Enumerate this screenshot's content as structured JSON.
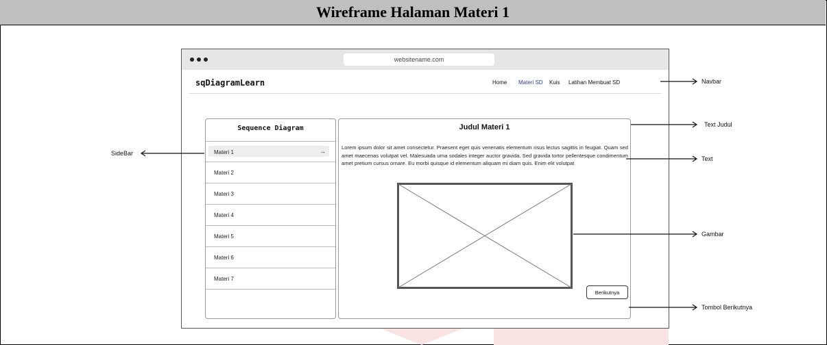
{
  "header": {
    "title": "Wireframe Halaman Materi 1"
  },
  "browser": {
    "url": "websitename.com",
    "brand": "sqDiagramLearn",
    "nav": [
      {
        "label": "Home",
        "active": false
      },
      {
        "label": "Materi SD",
        "active": true
      },
      {
        "label": "Kuis",
        "active": false
      },
      {
        "label": "Latihan Membuat SD",
        "active": false
      }
    ]
  },
  "sidebar": {
    "title": "Sequence Diagram",
    "items": [
      {
        "label": "Materi 1",
        "active": true,
        "arrow": "→"
      },
      {
        "label": "Materi 2",
        "active": false
      },
      {
        "label": "Materi 3",
        "active": false
      },
      {
        "label": "Materi 4",
        "active": false
      },
      {
        "label": "Materi 5",
        "active": false
      },
      {
        "label": "Materi 6",
        "active": false
      },
      {
        "label": "Materi 7",
        "active": false
      }
    ]
  },
  "content": {
    "title": "Judul Materi 1",
    "text": "Lorem ipsum dolor sit amet consectetur. Praesent eget quis venenatis elementum risus lectus sagittis in feugiat. Quam sed amet maecenas volutpat vel. Malesuada urna sodales integer auctor gravida. Sed gravida tortor pellentesque condimentum amet pretium cursus ornare. Eu morbi quisque id elementum aliquam mi diam quis. Enim elit volutpat",
    "next_button": "Berikutnya"
  },
  "annotations": {
    "navbar": "Navbar",
    "text_judul": "Text Judul",
    "text": "Text",
    "gambar": "Gambar",
    "tombol": "Tombol Berikutnya",
    "sidebar": "SideBar"
  }
}
